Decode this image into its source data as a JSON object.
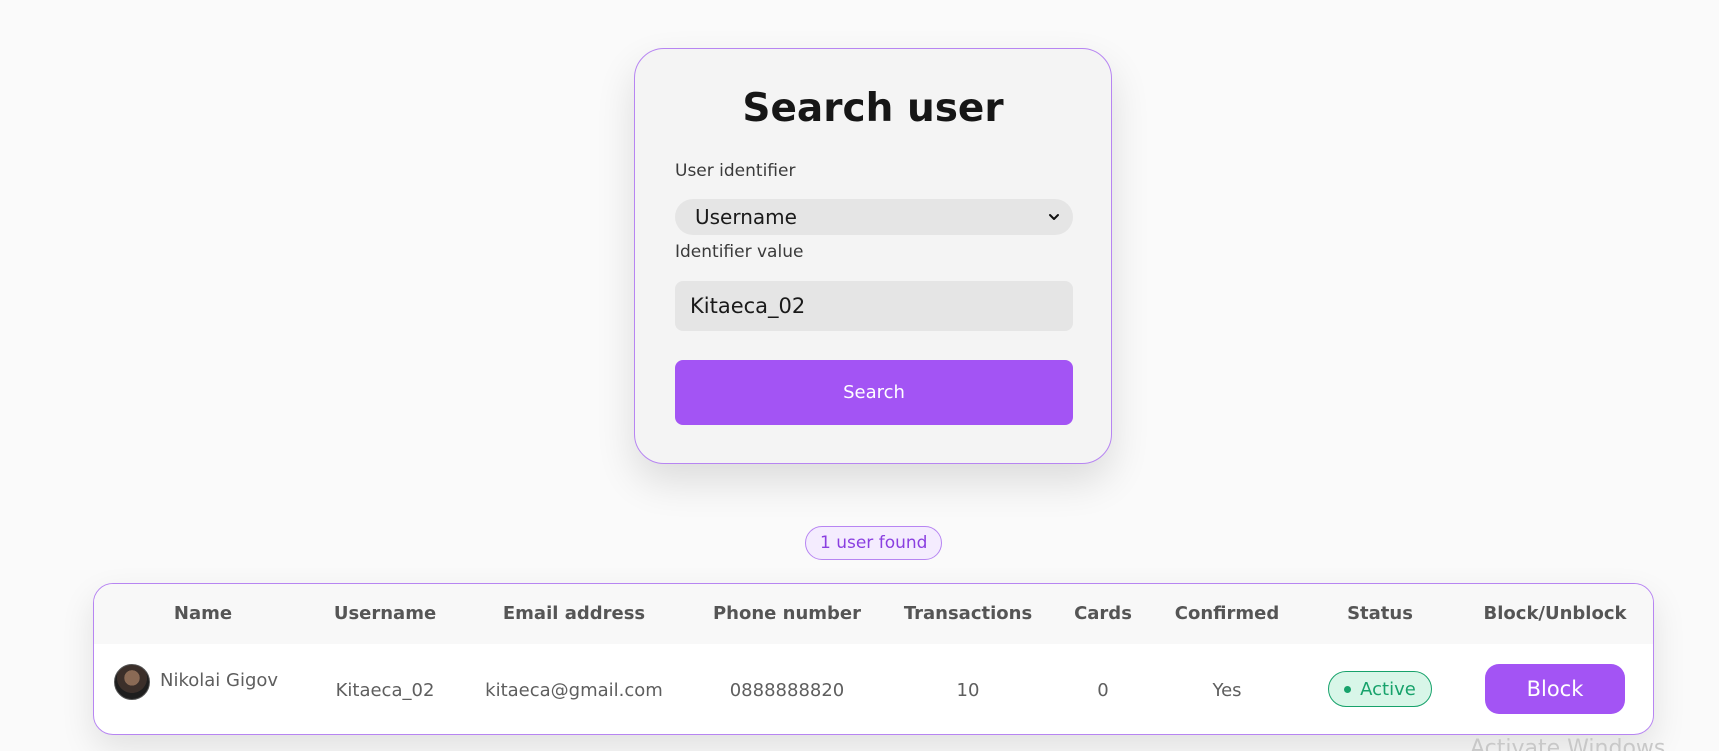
{
  "search_card": {
    "title": "Search user",
    "identifier_label": "User identifier",
    "identifier_selected": "Username",
    "value_label": "Identifier value",
    "value_input": "Kitaeca_02",
    "search_button": "Search"
  },
  "results": {
    "badge": "1 user found"
  },
  "table": {
    "headers": [
      "Name",
      "Username",
      "Email address",
      "Phone number",
      "Transactions",
      "Cards",
      "Confirmed",
      "Status",
      "Block/Unblock"
    ],
    "rows": [
      {
        "name": "Nikolai Gigov",
        "username": "Kitaeca_02",
        "email": "kitaeca@gmail.com",
        "phone": "0888888820",
        "transactions": "10",
        "cards": "0",
        "confirmed": "Yes",
        "status": "Active",
        "action": "Block"
      }
    ]
  },
  "watermark": "Activate Windows",
  "colors": {
    "accent": "#a354f4",
    "accent_border": "#b785f2",
    "status_active": "#17a26b"
  }
}
